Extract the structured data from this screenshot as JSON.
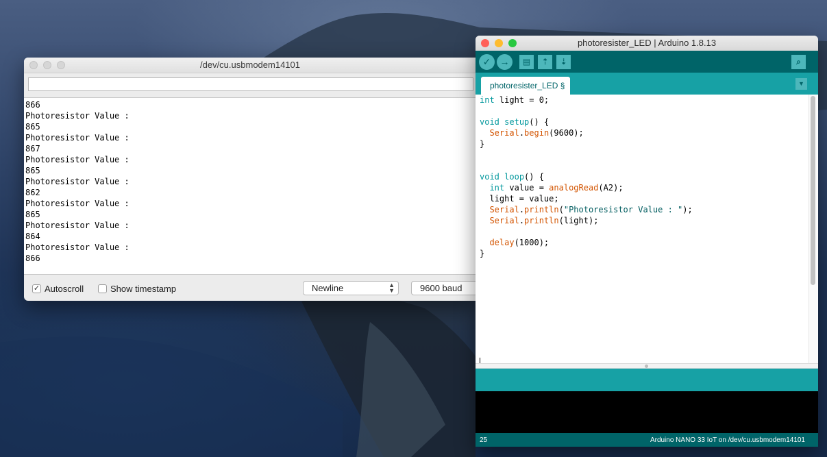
{
  "serial_monitor": {
    "title": "/dev/cu.usbmodem14101",
    "input_value": "",
    "output_lines": [
      "866",
      "Photoresistor Value :",
      "865",
      "Photoresistor Value :",
      "867",
      "Photoresistor Value :",
      "865",
      "Photoresistor Value :",
      "862",
      "Photoresistor Value :",
      "865",
      "Photoresistor Value :",
      "864",
      "Photoresistor Value :",
      "866"
    ],
    "autoscroll_label": "Autoscroll",
    "autoscroll_checked": true,
    "timestamp_label": "Show timestamp",
    "timestamp_checked": false,
    "line_ending": "Newline",
    "baud": "9600 baud"
  },
  "ide": {
    "title": "photoresister_LED | Arduino 1.8.13",
    "tab_label": "photoresister_LED §",
    "code_lines": [
      [
        {
          "t": "int",
          "c": "type"
        },
        {
          "t": " light = 0;"
        }
      ],
      [],
      [
        {
          "t": "void",
          "c": "type"
        },
        {
          "t": " "
        },
        {
          "t": "setup",
          "c": "type"
        },
        {
          "t": "() {"
        }
      ],
      [
        {
          "t": "  "
        },
        {
          "t": "Serial",
          "c": "func"
        },
        {
          "t": "."
        },
        {
          "t": "begin",
          "c": "func"
        },
        {
          "t": "(9600);"
        }
      ],
      [
        {
          "t": "}"
        }
      ],
      [],
      [],
      [
        {
          "t": "void",
          "c": "type"
        },
        {
          "t": " "
        },
        {
          "t": "loop",
          "c": "type"
        },
        {
          "t": "() {"
        }
      ],
      [
        {
          "t": "  "
        },
        {
          "t": "int",
          "c": "type"
        },
        {
          "t": " value = "
        },
        {
          "t": "analogRead",
          "c": "func"
        },
        {
          "t": "(A2);"
        }
      ],
      [
        {
          "t": "  light = value;"
        }
      ],
      [
        {
          "t": "  "
        },
        {
          "t": "Serial",
          "c": "func"
        },
        {
          "t": "."
        },
        {
          "t": "println",
          "c": "func"
        },
        {
          "t": "("
        },
        {
          "t": "\"Photoresistor Value : \"",
          "c": "str"
        },
        {
          "t": ");"
        }
      ],
      [
        {
          "t": "  "
        },
        {
          "t": "Serial",
          "c": "func"
        },
        {
          "t": "."
        },
        {
          "t": "println",
          "c": "func"
        },
        {
          "t": "(light);"
        }
      ],
      [],
      [
        {
          "t": "  "
        },
        {
          "t": "delay",
          "c": "func"
        },
        {
          "t": "(1000);"
        }
      ],
      [
        {
          "t": "}"
        }
      ]
    ],
    "status_line": "25",
    "status_board": "Arduino NANO 33 IoT on /dev/cu.usbmodem14101",
    "toolbar": {
      "verify_icon": "✓",
      "upload_icon": "→",
      "new_icon": "▤",
      "open_icon": "⇡",
      "save_icon": "⇣",
      "monitor_icon": "⌕",
      "tab_menu_icon": "▼"
    }
  },
  "colors": {
    "teal_dark": "#006468",
    "teal": "#17a1a5",
    "teal_light": "#4db7bb",
    "keyword": "#00979c",
    "function": "#d35400",
    "close": "#ff5f57",
    "minimize": "#febc2e",
    "maximize": "#28c840"
  }
}
